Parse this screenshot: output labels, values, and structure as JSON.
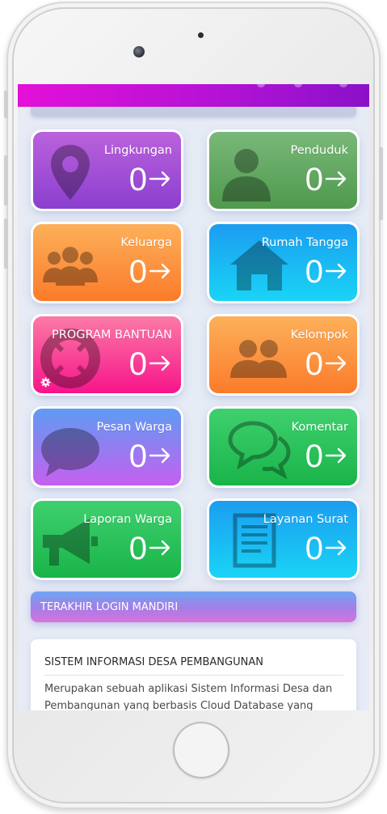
{
  "tiles": [
    {
      "label": "Lingkungan",
      "count": "0",
      "icon": "map-pin-icon",
      "gradient": [
        "#bb62dc",
        "#8b3fcf"
      ]
    },
    {
      "label": "Penduduk",
      "count": "0",
      "icon": "person-icon",
      "gradient": [
        "#79b879",
        "#4f994d"
      ]
    },
    {
      "label": "Keluarga",
      "count": "0",
      "icon": "group-icon",
      "gradient": [
        "#fdb05a",
        "#fb7b2a"
      ]
    },
    {
      "label": "Rumah Tangga",
      "count": "0",
      "icon": "house-icon",
      "gradient": [
        "#1b9df0",
        "#1ad4f6"
      ]
    },
    {
      "label": "PROGRAM BANTUAN",
      "count": "0",
      "icon": "lifebuoy-icon",
      "gradient": [
        "#fb7aa6",
        "#f7148a"
      ]
    },
    {
      "label": "Kelompok",
      "count": "0",
      "icon": "users-icon",
      "gradient": [
        "#fdb05a",
        "#fb7b2a"
      ]
    },
    {
      "label": "Pesan Warga",
      "count": "0",
      "icon": "chat-bubble-icon",
      "gradient": [
        "#5e9cf2",
        "#c65ff0"
      ]
    },
    {
      "label": "Komentar",
      "count": "0",
      "icon": "comments-icon",
      "gradient": [
        "#3fd06e",
        "#19b449"
      ]
    },
    {
      "label": "Laporan Warga",
      "count": "0",
      "icon": "megaphone-icon",
      "gradient": [
        "#3fd06e",
        "#19b449"
      ]
    },
    {
      "label": "Layanan Surat",
      "count": "0",
      "icon": "document-icon",
      "gradient": [
        "#1b9df0",
        "#1ad4f6"
      ]
    }
  ],
  "login": {
    "label": "TERAKHIR LOGIN MANDIRI"
  },
  "info": {
    "title": "SISTEM INFORMASI DESA PEMBANGUNAN",
    "body": "Merupakan sebuah aplikasi Sistem Informasi Desa dan Pembangunan yang berbasis Cloud Database yang"
  },
  "colors": {
    "header_start": "#e410d8",
    "header_end": "#8a11c8",
    "screen_bg": "#e6ebf5"
  }
}
